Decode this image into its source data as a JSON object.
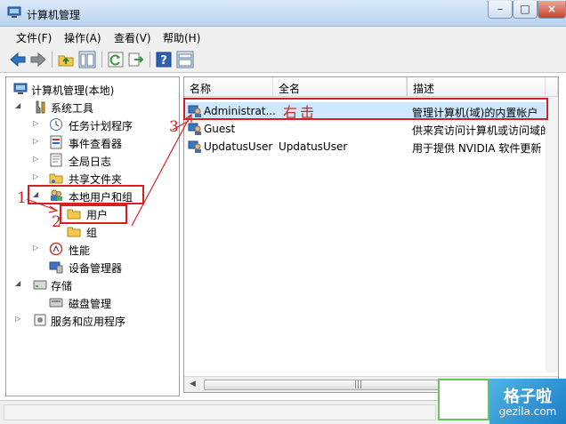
{
  "window": {
    "title": "计算机管理",
    "close_label": "×",
    "max_label": "□",
    "min_label": "–"
  },
  "menu": [
    {
      "label": "文件(F)"
    },
    {
      "label": "操作(A)"
    },
    {
      "label": "查看(V)"
    },
    {
      "label": "帮助(H)"
    }
  ],
  "tree": [
    {
      "label": "计算机管理(本地)",
      "icon": "computer-management-icon",
      "arrow": ""
    },
    {
      "label": "系统工具",
      "icon": "tools-icon",
      "arrow": "◢"
    },
    {
      "label": "任务计划程序",
      "icon": "clock-icon",
      "arrow": "▷"
    },
    {
      "label": "事件查看器",
      "icon": "event-viewer-icon",
      "arrow": "▷"
    },
    {
      "label": "全局日志",
      "icon": "log-icon",
      "arrow": "▷"
    },
    {
      "label": "共享文件夹",
      "icon": "shared-folder-icon",
      "arrow": "▷"
    },
    {
      "label": "本地用户和组",
      "icon": "users-group-icon",
      "arrow": "◢"
    },
    {
      "label": "用户",
      "icon": "folder-icon",
      "arrow": ""
    },
    {
      "label": "组",
      "icon": "folder-icon",
      "arrow": ""
    },
    {
      "label": "性能",
      "icon": "performance-icon",
      "arrow": "▷"
    },
    {
      "label": "设备管理器",
      "icon": "device-manager-icon",
      "arrow": ""
    },
    {
      "label": "存储",
      "icon": "storage-icon",
      "arrow": "◢"
    },
    {
      "label": "磁盘管理",
      "icon": "disk-icon",
      "arrow": ""
    },
    {
      "label": "服务和应用程序",
      "icon": "services-icon",
      "arrow": "▷"
    }
  ],
  "list": {
    "columns": [
      "名称",
      "全名",
      "描述"
    ],
    "rows": [
      {
        "name": "Administrat...",
        "full_name": "",
        "description": "管理计算机(域)的内置帐户"
      },
      {
        "name": "Guest",
        "full_name": "",
        "description": "供来宾访问计算机或访问域的内"
      },
      {
        "name": "UpdatusUser",
        "full_name": "UpdatusUser",
        "description": "用于提供 NVIDIA 软件更新"
      }
    ]
  },
  "annotations": {
    "n1": "1",
    "n2": "2",
    "n3": "3",
    "right_click": "右击"
  },
  "watermark": {
    "cn": "格子啦",
    "en": "gezila.com"
  },
  "colors": {
    "annotation": "#d81e1e",
    "selection": "#cde8ff",
    "watermark": "#1c7fc5"
  }
}
